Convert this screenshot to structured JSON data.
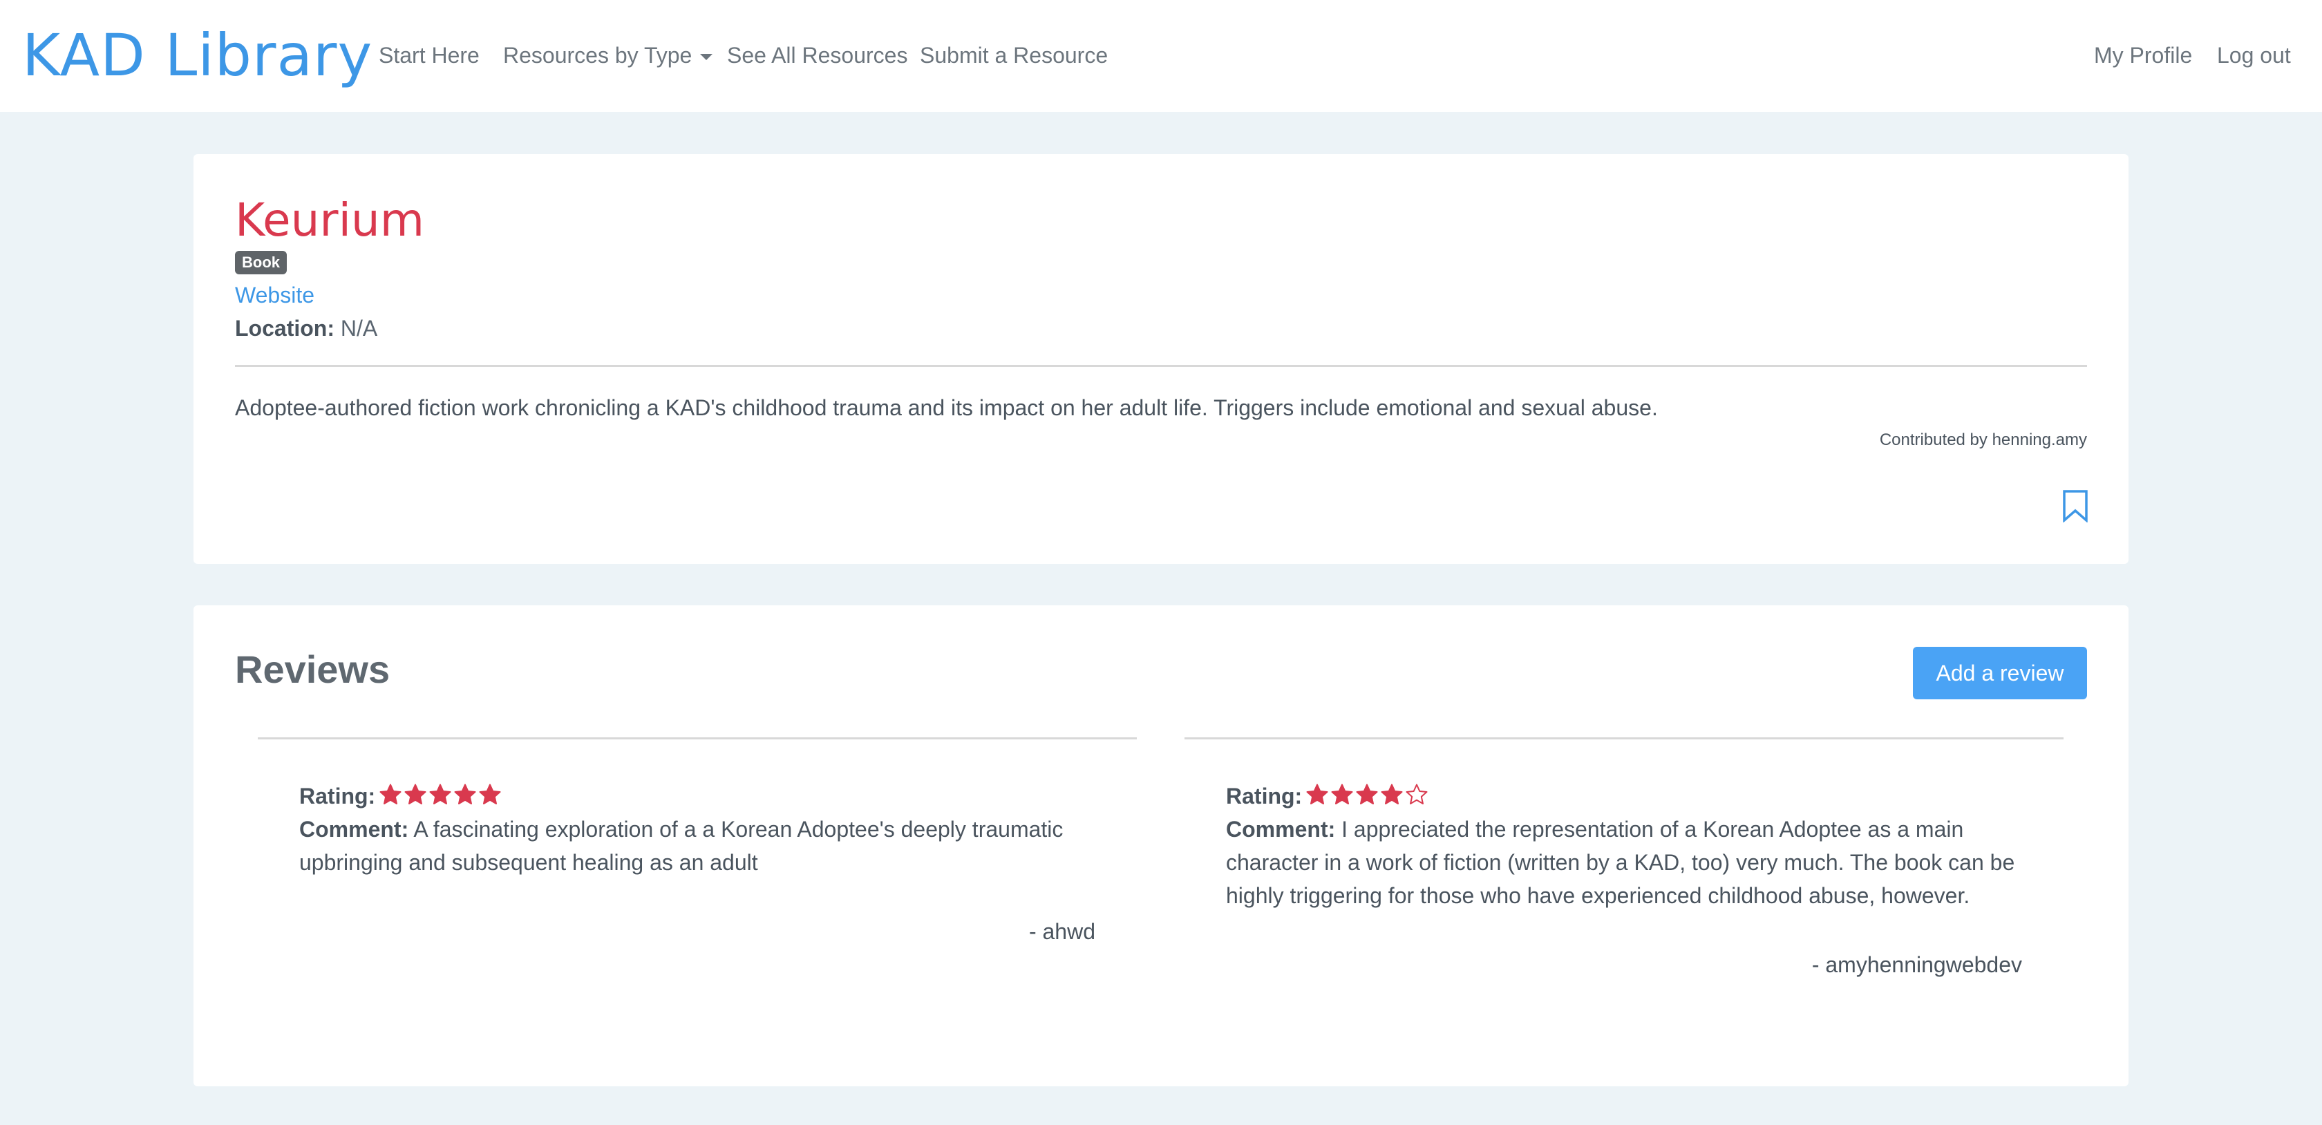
{
  "nav": {
    "brand": "KAD Library",
    "links": [
      "Start Here",
      "Resources by Type",
      "See All Resources",
      "Submit a Resource"
    ],
    "right_links": [
      "My Profile",
      "Log out"
    ]
  },
  "resource": {
    "title": "Keurium",
    "badge": "Book",
    "website_label": "Website",
    "location_label": "Location:",
    "location_value": "N/A",
    "description": "Adoptee-authored fiction work chronicling a KAD's childhood trauma and its impact on her adult life. Triggers include emotional and sexual abuse.",
    "contributed": "Contributed by henning.amy",
    "bookmark_icon": "bookmark-icon"
  },
  "reviews": {
    "title": "Reviews",
    "add_label": "Add a review",
    "items": [
      {
        "rating_label": "Rating:",
        "rating": 5,
        "comment_label": "Comment:",
        "comment": "A fascinating exploration of a a Korean Adoptee's deeply traumatic upbringing and subsequent healing as an adult",
        "author": "- ahwd"
      },
      {
        "rating_label": "Rating:",
        "rating": 4,
        "comment_label": "Comment:",
        "comment": "I appreciated the representation of a Korean Adoptee as a main character in a work of fiction (written by a KAD, too) very much. The book can be highly triggering for those who have experienced childhood abuse, however.",
        "author": "- amyhenningwebdev"
      }
    ]
  },
  "colors": {
    "accent": "#3d97e6",
    "title": "#d9394e",
    "star": "#d9394e",
    "button": "#4aa3f5",
    "background": "#ecf3f7"
  }
}
